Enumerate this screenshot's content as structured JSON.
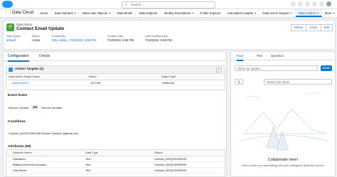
{
  "topbar": {
    "search_placeholder": "Search..."
  },
  "nav": {
    "app_name": "Data Cloud",
    "tabs": [
      {
        "label": "Home",
        "chevron": false,
        "active": false
      },
      {
        "label": "Data Streams",
        "chevron": true,
        "active": false
      },
      {
        "label": "Data Lake Objects",
        "chevron": true,
        "active": false
      },
      {
        "label": "Data Model",
        "chevron": false,
        "active": false
      },
      {
        "label": "Data Explorer",
        "chevron": false,
        "active": false
      },
      {
        "label": "Identity Resolutions",
        "chevron": true,
        "active": false
      },
      {
        "label": "Profile Explorer",
        "chevron": false,
        "active": false
      },
      {
        "label": "Calculated Insights",
        "chevron": true,
        "active": false
      },
      {
        "label": "Data Action Targets",
        "chevron": true,
        "active": false
      },
      {
        "label": "Data Actions",
        "chevron": true,
        "active": true
      },
      {
        "label": "More",
        "chevron": true,
        "active": false
      }
    ]
  },
  "record": {
    "type_label": "Data Action",
    "title": "Contact Email Update",
    "buttons": [
      "Delete",
      "Clone",
      "Edit"
    ],
    "fields": [
      {
        "label": "Data Space",
        "value": "default",
        "link": true
      },
      {
        "label": "Status",
        "value": "Active",
        "link": false
      },
      {
        "label": "Created By",
        "value": "Toby Admin, 7/10/2023, 6:58 PM",
        "link": true
      },
      {
        "label": "Created Date",
        "value": "7/10/2023, 6:58 PM",
        "link": false
      },
      {
        "label": "Last Modified Date",
        "value": "7/10/2023, 6:58 PM",
        "link": false
      }
    ]
  },
  "detail_tabs": [
    "Configuration",
    "Details"
  ],
  "action_targets": {
    "title": "Action Targets (1)",
    "columns": [
      "Data Action Target Name",
      "Status",
      "Target Type"
    ],
    "rows": [
      [
        "Webhook472",
        "ACTIVE",
        "Webhook"
      ]
    ]
  },
  "event_rules": {
    "title": "Event Rules",
    "left": "Record Created",
    "op": "OR",
    "right": "Record Updated"
  },
  "conditions": {
    "title": "Conditions",
    "text": "Contact_0003Z1000000Ef.Email Contains @gmail.com"
  },
  "attributes": {
    "title": "Attributes (59)",
    "columns": [
      "Attribute Name",
      "Data Type",
      "Object"
    ],
    "rows": [
      [
        "Salutation",
        "Text",
        "Contact_000Q7000000Sf"
      ],
      [
        "Mailing Geocode Accuracy",
        "Text",
        "Contact_000Q7000000Sf"
      ],
      [
        "Last Name",
        "Text",
        "Contact_000Q7000000Sf"
      ]
    ]
  },
  "feed": {
    "tabs": [
      "Post",
      "Poll",
      "Question"
    ],
    "share_placeholder": "Share an update...",
    "share_button": "Share",
    "search_placeholder": "Search this feed...",
    "collab_title": "Collaborate here!",
    "collab_sub": "Here's where you start talking with your colleagues about this record."
  }
}
